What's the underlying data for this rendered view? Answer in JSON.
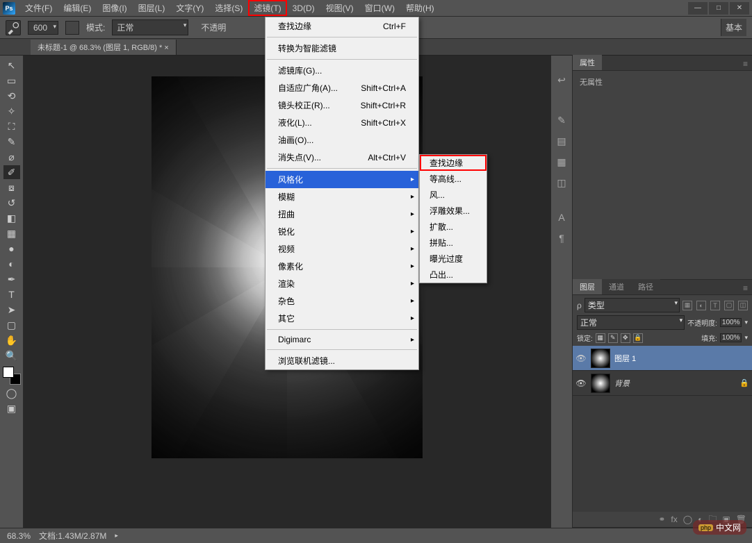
{
  "menubar": {
    "items": [
      "文件(F)",
      "编辑(E)",
      "图像(I)",
      "图层(L)",
      "文字(Y)",
      "选择(S)",
      "滤镜(T)",
      "3D(D)",
      "视图(V)",
      "窗口(W)",
      "帮助(H)"
    ],
    "highlighted_index": 6
  },
  "options": {
    "brush_size": "600",
    "mode_label": "模式:",
    "mode_value": "正常",
    "opacity_label": "不透明",
    "right_btn": "基本"
  },
  "doc_tab": "未标题-1 @ 68.3% (图层 1, RGB/8) * ×",
  "filter_menu": {
    "top": {
      "label": "查找边缘",
      "shortcut": "Ctrl+F"
    },
    "convert": "转换为智能滤镜",
    "group1": [
      {
        "label": "滤镜库(G)...",
        "shortcut": ""
      },
      {
        "label": "自适应广角(A)...",
        "shortcut": "Shift+Ctrl+A"
      },
      {
        "label": "镜头校正(R)...",
        "shortcut": "Shift+Ctrl+R"
      },
      {
        "label": "液化(L)...",
        "shortcut": "Shift+Ctrl+X"
      },
      {
        "label": "油画(O)...",
        "shortcut": ""
      },
      {
        "label": "消失点(V)...",
        "shortcut": "Alt+Ctrl+V"
      }
    ],
    "group2": [
      "风格化",
      "模糊",
      "扭曲",
      "锐化",
      "视频",
      "像素化",
      "渲染",
      "杂色",
      "其它"
    ],
    "group2_highlighted_index": 0,
    "digimarc": "Digimarc",
    "browse": "浏览联机滤镜..."
  },
  "stylize_submenu": [
    "查找边缘",
    "等高线...",
    "风...",
    "浮雕效果...",
    "扩散...",
    "拼贴...",
    "曝光过度",
    "凸出..."
  ],
  "stylize_highlighted_index": 0,
  "properties": {
    "tab": "属性",
    "body": "无属性"
  },
  "layers_panel": {
    "tabs": [
      "图层",
      "通道",
      "路径"
    ],
    "type_label": "类型",
    "blend_mode": "正常",
    "opacity_label": "不透明度:",
    "opacity_value": "100%",
    "lock_label": "锁定:",
    "fill_label": "填充:",
    "fill_value": "100%",
    "layers": [
      {
        "name": "图层 1",
        "selected": true,
        "locked": false
      },
      {
        "name": "背景",
        "selected": false,
        "locked": true
      }
    ]
  },
  "status": {
    "zoom": "68.3%",
    "doc": "文档:1.43M/2.87M"
  },
  "watermark": "中文网"
}
